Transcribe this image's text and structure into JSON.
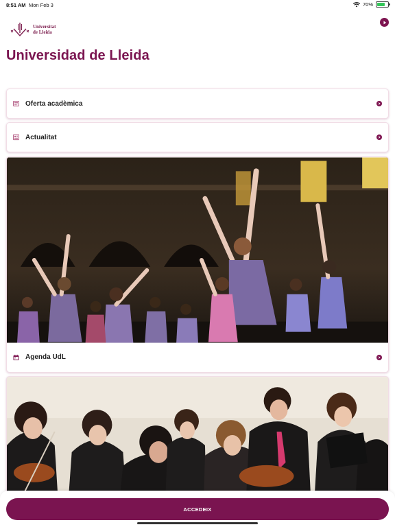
{
  "status_bar": {
    "time": "8:51 AM",
    "date": "Mon Feb 3",
    "battery": "70%",
    "battery_level": 0.7
  },
  "header": {
    "logo_line1": "Universitat",
    "logo_line2": "de Lleida",
    "title": "Universidad de Lleida"
  },
  "items": [
    {
      "label": "Oferta acadèmica",
      "icon": "catalog-icon"
    },
    {
      "label": "Actualitat",
      "icon": "news-icon"
    }
  ],
  "cards": [
    {
      "label": "Agenda UdL",
      "icon": "calendar-icon",
      "image": "dancers-photo"
    },
    {
      "image": "orchestra-photo"
    }
  ],
  "footer": {
    "cta_label": "ACCEDEIX"
  },
  "colors": {
    "brand": "#7a1450",
    "border": "#f1dde6"
  }
}
